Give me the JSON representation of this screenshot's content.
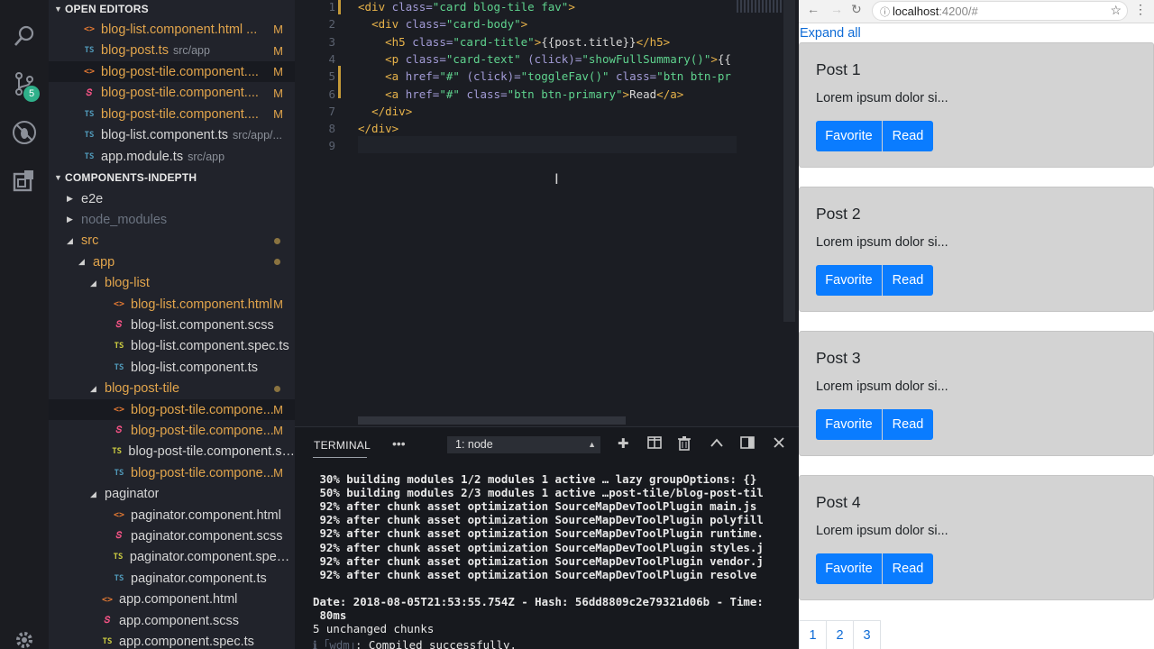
{
  "activity_bar": {
    "badge": "5",
    "icons": [
      "search-icon",
      "source-control-icon",
      "debug-icon",
      "extensions-icon",
      "settings-gear-icon"
    ]
  },
  "sidebar": {
    "open_editors_header": "OPEN EDITORS",
    "open_editors": [
      {
        "icon": "html",
        "name": "blog-list.component.html ...",
        "path": "",
        "mod": "M",
        "active": false
      },
      {
        "icon": "ts",
        "name": "blog-post.ts",
        "path": "src/app",
        "mod": "M",
        "active": false
      },
      {
        "icon": "html",
        "name": "blog-post-tile.component....",
        "path": "",
        "mod": "M",
        "active": true
      },
      {
        "icon": "scss",
        "name": "blog-post-tile.component....",
        "path": "",
        "mod": "M",
        "active": false
      },
      {
        "icon": "ts",
        "name": "blog-post-tile.component....",
        "path": "",
        "mod": "M",
        "active": false
      },
      {
        "icon": "ts",
        "name": "blog-list.component.ts",
        "path": "src/app/...",
        "mod": "",
        "active": false
      },
      {
        "icon": "ts",
        "name": "app.module.ts",
        "path": "src/app",
        "mod": "",
        "active": false
      }
    ],
    "project_header": "COMPONENTS-INDEPTH",
    "tree": [
      {
        "kind": "folder",
        "open": false,
        "name": "e2e",
        "color": "norm",
        "indent": 0
      },
      {
        "kind": "folder",
        "open": false,
        "name": "node_modules",
        "color": "dim",
        "indent": 0
      },
      {
        "kind": "folder",
        "open": true,
        "name": "src",
        "color": "mod",
        "indent": 0,
        "dot": true
      },
      {
        "kind": "folder",
        "open": true,
        "name": "app",
        "color": "mod",
        "indent": 1,
        "dot": true
      },
      {
        "kind": "folder",
        "open": true,
        "name": "blog-list",
        "color": "mod",
        "indent": 2
      },
      {
        "kind": "file",
        "icon": "html",
        "name": "blog-list.component.html",
        "color": "mod",
        "indent": 3,
        "mod": "M"
      },
      {
        "kind": "file",
        "icon": "scss",
        "name": "blog-list.component.scss",
        "color": "norm",
        "indent": 3
      },
      {
        "kind": "file",
        "icon": "spec",
        "name": "blog-list.component.spec.ts",
        "color": "norm",
        "indent": 3
      },
      {
        "kind": "file",
        "icon": "ts",
        "name": "blog-list.component.ts",
        "color": "norm",
        "indent": 3
      },
      {
        "kind": "folder",
        "open": true,
        "name": "blog-post-tile",
        "color": "mod",
        "indent": 2,
        "dot": true
      },
      {
        "kind": "file",
        "icon": "html",
        "name": "blog-post-tile.compone...",
        "color": "mod",
        "indent": 3,
        "mod": "M",
        "active": true
      },
      {
        "kind": "file",
        "icon": "scss",
        "name": "blog-post-tile.compone...",
        "color": "mod",
        "indent": 3,
        "mod": "M"
      },
      {
        "kind": "file",
        "icon": "spec",
        "name": "blog-post-tile.component.sp...",
        "color": "norm",
        "indent": 3
      },
      {
        "kind": "file",
        "icon": "ts",
        "name": "blog-post-tile.compone...",
        "color": "mod",
        "indent": 3,
        "mod": "M"
      },
      {
        "kind": "folder",
        "open": true,
        "name": "paginator",
        "color": "norm",
        "indent": 2
      },
      {
        "kind": "file",
        "icon": "html",
        "name": "paginator.component.html",
        "color": "norm",
        "indent": 3
      },
      {
        "kind": "file",
        "icon": "scss",
        "name": "paginator.component.scss",
        "color": "norm",
        "indent": 3
      },
      {
        "kind": "file",
        "icon": "spec",
        "name": "paginator.component.spec.ts",
        "color": "norm",
        "indent": 3
      },
      {
        "kind": "file",
        "icon": "ts",
        "name": "paginator.component.ts",
        "color": "norm",
        "indent": 3
      },
      {
        "kind": "file",
        "icon": "html",
        "name": "app.component.html",
        "color": "norm",
        "indent": 2
      },
      {
        "kind": "file",
        "icon": "scss",
        "name": "app.component.scss",
        "color": "norm",
        "indent": 2
      },
      {
        "kind": "file",
        "icon": "spec",
        "name": "app.component.spec.ts",
        "color": "norm",
        "indent": 2
      }
    ]
  },
  "editor": {
    "lines": [
      {
        "n": "1",
        "tokens": [
          [
            "tag",
            "<div "
          ],
          [
            "attr",
            "class="
          ],
          [
            "str",
            "\"card blog-tile fav\""
          ],
          [
            "tag",
            ">"
          ]
        ]
      },
      {
        "n": "2",
        "tokens": [
          [
            "txt",
            "  "
          ],
          [
            "tag",
            "<div "
          ],
          [
            "attr",
            "class="
          ],
          [
            "str",
            "\"card-body\""
          ],
          [
            "tag",
            ">"
          ]
        ]
      },
      {
        "n": "3",
        "tokens": [
          [
            "txt",
            "    "
          ],
          [
            "tag",
            "<h5 "
          ],
          [
            "attr",
            "class="
          ],
          [
            "str",
            "\"card-title\""
          ],
          [
            "tag",
            ">"
          ],
          [
            "txt",
            "{{post.title}}"
          ],
          [
            "tag",
            "</h5>"
          ]
        ]
      },
      {
        "n": "4",
        "tokens": [
          [
            "txt",
            "    "
          ],
          [
            "tag",
            "<p "
          ],
          [
            "attr",
            "class="
          ],
          [
            "str",
            "\"card-text\" "
          ],
          [
            "attr",
            "(click)="
          ],
          [
            "str",
            "\"showFullSummary()\""
          ],
          [
            "tag",
            ">"
          ],
          [
            "txt",
            "{{"
          ]
        ]
      },
      {
        "n": "5",
        "tokens": [
          [
            "txt",
            "    "
          ],
          [
            "tag",
            "<a "
          ],
          [
            "attr",
            "href="
          ],
          [
            "str",
            "\"#\" "
          ],
          [
            "attr",
            "(click)="
          ],
          [
            "str",
            "\"toggleFav()\" "
          ],
          [
            "attr",
            "class="
          ],
          [
            "str",
            "\"btn btn-pr"
          ]
        ]
      },
      {
        "n": "6",
        "tokens": [
          [
            "txt",
            "    "
          ],
          [
            "tag",
            "<a "
          ],
          [
            "attr",
            "href="
          ],
          [
            "str",
            "\"#\" "
          ],
          [
            "attr",
            "class="
          ],
          [
            "str",
            "\"btn btn-primary\""
          ],
          [
            "tag",
            ">"
          ],
          [
            "txt",
            "Read"
          ],
          [
            "tag",
            "</a>"
          ]
        ]
      },
      {
        "n": "7",
        "tokens": [
          [
            "txt",
            "  "
          ],
          [
            "tag",
            "</div>"
          ]
        ]
      },
      {
        "n": "8",
        "tokens": [
          [
            "tag",
            "</div>"
          ]
        ]
      },
      {
        "n": "9",
        "tokens": []
      }
    ]
  },
  "terminal": {
    "tab_label": "TERMINAL",
    "more": "•••",
    "selected_terminal": "1: node",
    "output": [
      " 30% building modules 1/2 modules 1 active … lazy groupOptions: {}",
      " 50% building modules 2/3 modules 1 active …post-tile/blog-post-til",
      " 92% after chunk asset optimization SourceMapDevToolPlugin main.js",
      " 92% after chunk asset optimization SourceMapDevToolPlugin polyfill",
      " 92% after chunk asset optimization SourceMapDevToolPlugin runtime.",
      " 92% after chunk asset optimization SourceMapDevToolPlugin styles.j",
      " 92% after chunk asset optimization SourceMapDevToolPlugin vendor.j",
      " 92% after chunk asset optimization SourceMapDevToolPlugin resolve"
    ],
    "summary_line1": "Date: 2018-08-05T21:53:55.754Z - Hash: 56dd8809c2e79321d06b - Time:",
    "summary_line2": " 80ms",
    "chunks_line": "5 unchanged chunks",
    "wdm_prefix": "ℹ ｢wdm｣",
    "wdm_msg": ": Compiled successfully."
  },
  "browser": {
    "url_host": "localhost",
    "url_path": ":4200/#",
    "expand_all": "Expand all",
    "posts": [
      {
        "title": "Post 1",
        "text": "Lorem ipsum dolor si..."
      },
      {
        "title": "Post 2",
        "text": "Lorem ipsum dolor si..."
      },
      {
        "title": "Post 3",
        "text": "Lorem ipsum dolor si..."
      },
      {
        "title": "Post 4",
        "text": "Lorem ipsum dolor si..."
      }
    ],
    "favorite_label": "Favorite",
    "read_label": "Read",
    "pages": [
      "1",
      "2",
      "3"
    ]
  }
}
